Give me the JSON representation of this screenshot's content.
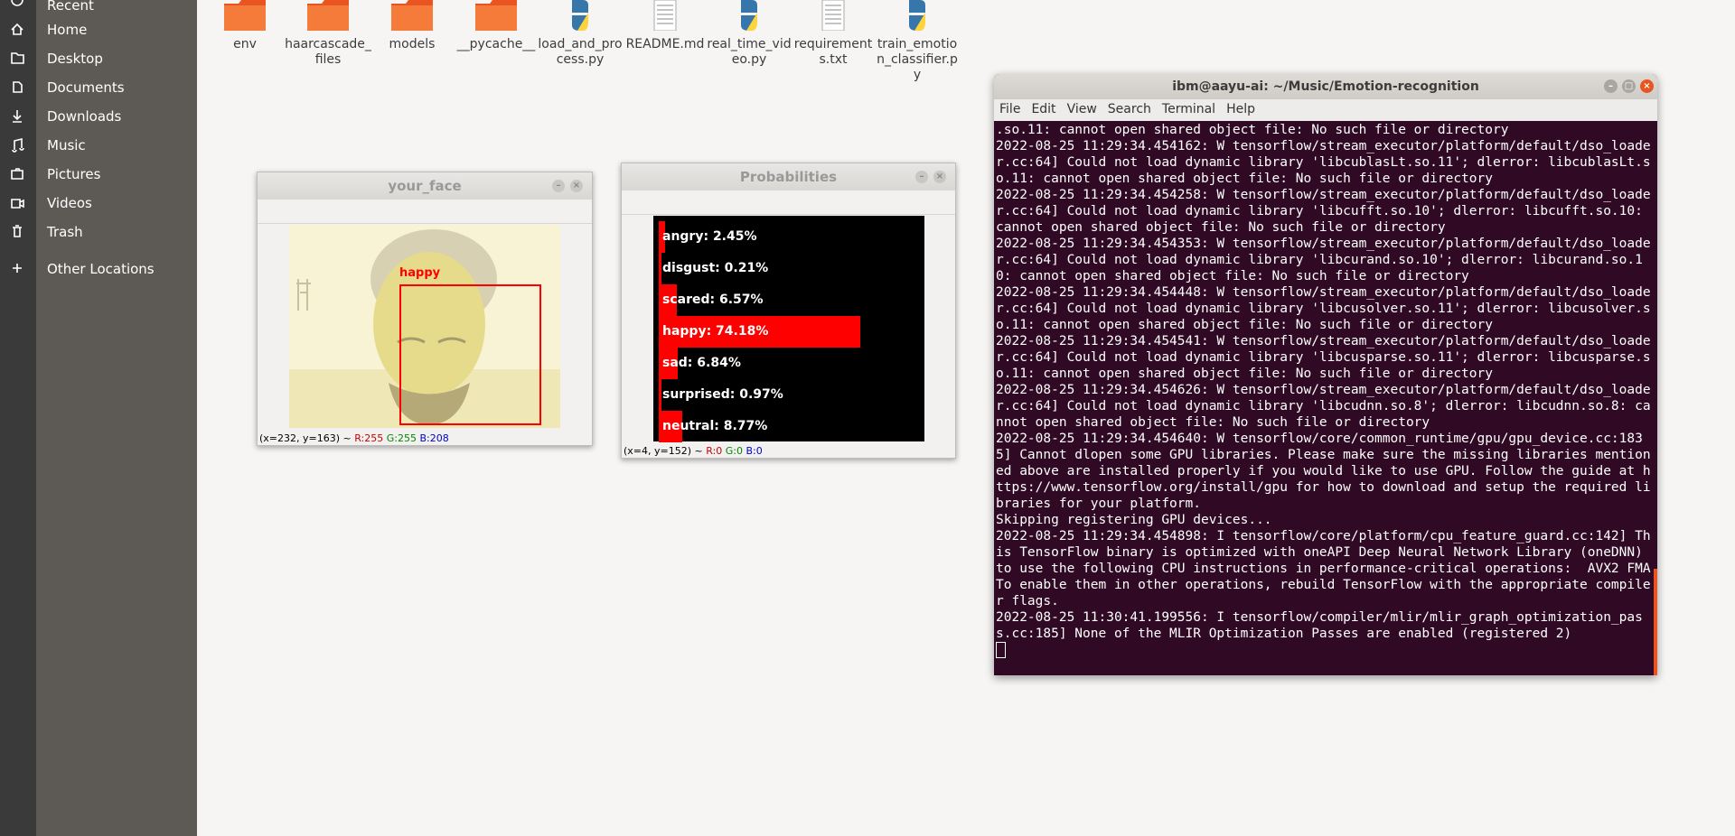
{
  "sidebar": {
    "items": [
      {
        "label": "Recent",
        "icon": "clock-icon"
      },
      {
        "label": "Home",
        "icon": "home-icon"
      },
      {
        "label": "Desktop",
        "icon": "folder-icon"
      },
      {
        "label": "Documents",
        "icon": "document-icon"
      },
      {
        "label": "Downloads",
        "icon": "download-icon"
      },
      {
        "label": "Music",
        "icon": "music-icon"
      },
      {
        "label": "Pictures",
        "icon": "camera-icon"
      },
      {
        "label": "Videos",
        "icon": "video-icon"
      },
      {
        "label": "Trash",
        "icon": "trash-icon"
      },
      {
        "label": "Other Locations",
        "icon": "plus-icon"
      }
    ]
  },
  "files": [
    {
      "name": "env",
      "type": "folder"
    },
    {
      "name": "haarcascade_files",
      "type": "folder"
    },
    {
      "name": "models",
      "type": "folder"
    },
    {
      "name": "__pycache__",
      "type": "folder"
    },
    {
      "name": "load_and_process.py",
      "type": "python"
    },
    {
      "name": "README.md",
      "type": "text"
    },
    {
      "name": "real_time_video.py",
      "type": "python"
    },
    {
      "name": "requirements.txt",
      "type": "text"
    },
    {
      "name": "train_emotion_classifier.py",
      "type": "python"
    }
  ],
  "face_window": {
    "title": "your_face",
    "label": "happy",
    "status_coords": "(x=232, y=163) ~",
    "status_r": "R:255",
    "status_g": "G:255",
    "status_b": "B:208"
  },
  "prob_window": {
    "title": "Probabilities",
    "bars": [
      {
        "label": "angry: 2.45%",
        "value": 0.0245
      },
      {
        "label": "disgust: 0.21%",
        "value": 0.0021
      },
      {
        "label": "scared: 6.57%",
        "value": 0.0657
      },
      {
        "label": "happy: 74.18%",
        "value": 0.7418
      },
      {
        "label": "sad: 6.84%",
        "value": 0.0684
      },
      {
        "label": "surprised: 0.97%",
        "value": 0.0097
      },
      {
        "label": "neutral: 8.77%",
        "value": 0.0877
      }
    ],
    "status_coords": "(x=4, y=152) ~",
    "status_r": "R:0",
    "status_g": "G:0",
    "status_b": "B:0"
  },
  "terminal": {
    "title": "ibm@aayu-ai: ~/Music/Emotion-recognition",
    "menu": [
      "File",
      "Edit",
      "View",
      "Search",
      "Terminal",
      "Help"
    ],
    "text": ".so.11: cannot open shared object file: No such file or directory\n2022-08-25 11:29:34.454162: W tensorflow/stream_executor/platform/default/dso_loader.cc:64] Could not load dynamic library 'libcublasLt.so.11'; dlerror: libcublasLt.so.11: cannot open shared object file: No such file or directory\n2022-08-25 11:29:34.454258: W tensorflow/stream_executor/platform/default/dso_loader.cc:64] Could not load dynamic library 'libcufft.so.10'; dlerror: libcufft.so.10: cannot open shared object file: No such file or directory\n2022-08-25 11:29:34.454353: W tensorflow/stream_executor/platform/default/dso_loader.cc:64] Could not load dynamic library 'libcurand.so.10'; dlerror: libcurand.so.10: cannot open shared object file: No such file or directory\n2022-08-25 11:29:34.454448: W tensorflow/stream_executor/platform/default/dso_loader.cc:64] Could not load dynamic library 'libcusolver.so.11'; dlerror: libcusolver.so.11: cannot open shared object file: No such file or directory\n2022-08-25 11:29:34.454541: W tensorflow/stream_executor/platform/default/dso_loader.cc:64] Could not load dynamic library 'libcusparse.so.11'; dlerror: libcusparse.so.11: cannot open shared object file: No such file or directory\n2022-08-25 11:29:34.454626: W tensorflow/stream_executor/platform/default/dso_loader.cc:64] Could not load dynamic library 'libcudnn.so.8'; dlerror: libcudnn.so.8: cannot open shared object file: No such file or directory\n2022-08-25 11:29:34.454640: W tensorflow/core/common_runtime/gpu/gpu_device.cc:1835] Cannot dlopen some GPU libraries. Please make sure the missing libraries mentioned above are installed properly if you would like to use GPU. Follow the guide at https://www.tensorflow.org/install/gpu for how to download and setup the required libraries for your platform.\nSkipping registering GPU devices...\n2022-08-25 11:29:34.454898: I tensorflow/core/platform/cpu_feature_guard.cc:142] This TensorFlow binary is optimized with oneAPI Deep Neural Network Library (oneDNN) to use the following CPU instructions in performance-critical operations:  AVX2 FMA\nTo enable them in other operations, rebuild TensorFlow with the appropriate compiler flags.\n2022-08-25 11:30:41.199556: I tensorflow/compiler/mlir/mlir_graph_optimization_pass.cc:185] None of the MLIR Optimization Passes are enabled (registered 2)"
  }
}
